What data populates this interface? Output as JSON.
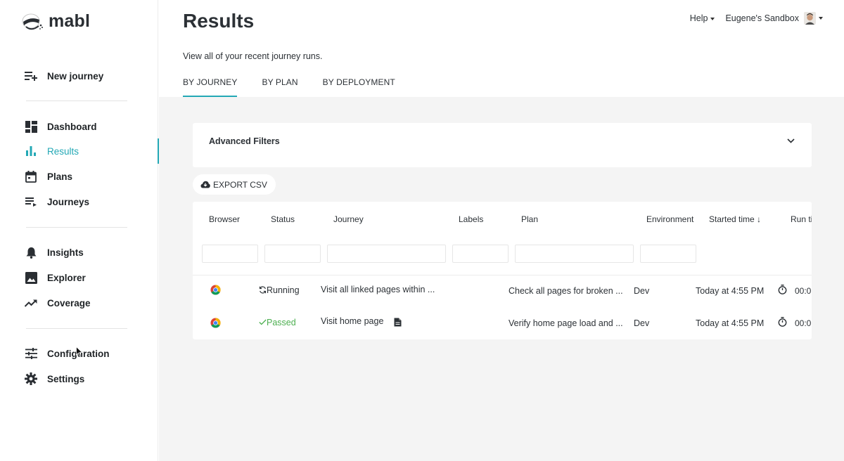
{
  "app": {
    "logo_text": "mabl"
  },
  "sidebar": {
    "items": [
      {
        "label": "New journey",
        "icon": "playlist-add-icon"
      },
      {
        "label": "Dashboard",
        "icon": "dashboard-icon"
      },
      {
        "label": "Results",
        "icon": "bar-chart-icon",
        "active": true
      },
      {
        "label": "Plans",
        "icon": "calendar-icon"
      },
      {
        "label": "Journeys",
        "icon": "list-icon"
      },
      {
        "label": "Insights",
        "icon": "bell-icon"
      },
      {
        "label": "Explorer",
        "icon": "image-icon"
      },
      {
        "label": "Coverage",
        "icon": "trending-up-icon"
      },
      {
        "label": "Configuration",
        "icon": "sliders-icon"
      },
      {
        "label": "Settings",
        "icon": "gear-icon"
      }
    ]
  },
  "header": {
    "title": "Results",
    "subtitle": "View all of your recent journey runs.",
    "help_label": "Help",
    "workspace_label": "Eugene's Sandbox"
  },
  "tabs": [
    {
      "label": "BY JOURNEY",
      "active": true
    },
    {
      "label": "BY PLAN"
    },
    {
      "label": "BY DEPLOYMENT"
    }
  ],
  "filters": {
    "title": "Advanced Filters"
  },
  "export": {
    "label": "EXPORT CSV"
  },
  "table": {
    "columns": [
      "Browser",
      "Status",
      "Journey",
      "Labels",
      "Plan",
      "Environment",
      "Started time",
      "Run ti"
    ],
    "sort_indicator": "↓",
    "rows": [
      {
        "browser": "chrome-icon",
        "status": "Running",
        "journey": "Visit all linked pages within ...",
        "labels": "",
        "plan": "Check all pages for broken ...",
        "environment": "Dev",
        "started": "Today at 4:55 PM",
        "run_time": "00:0"
      },
      {
        "browser": "chrome-icon",
        "status": "Passed",
        "journey": "Visit home page",
        "labels": "",
        "plan": "Verify home page load and ...",
        "environment": "Dev",
        "started": "Today at 4:55 PM",
        "run_time": "00:0"
      }
    ]
  },
  "colors": {
    "accent": "#23a8b5",
    "passed": "#4caf50",
    "content_bg": "#f4f4f4"
  }
}
